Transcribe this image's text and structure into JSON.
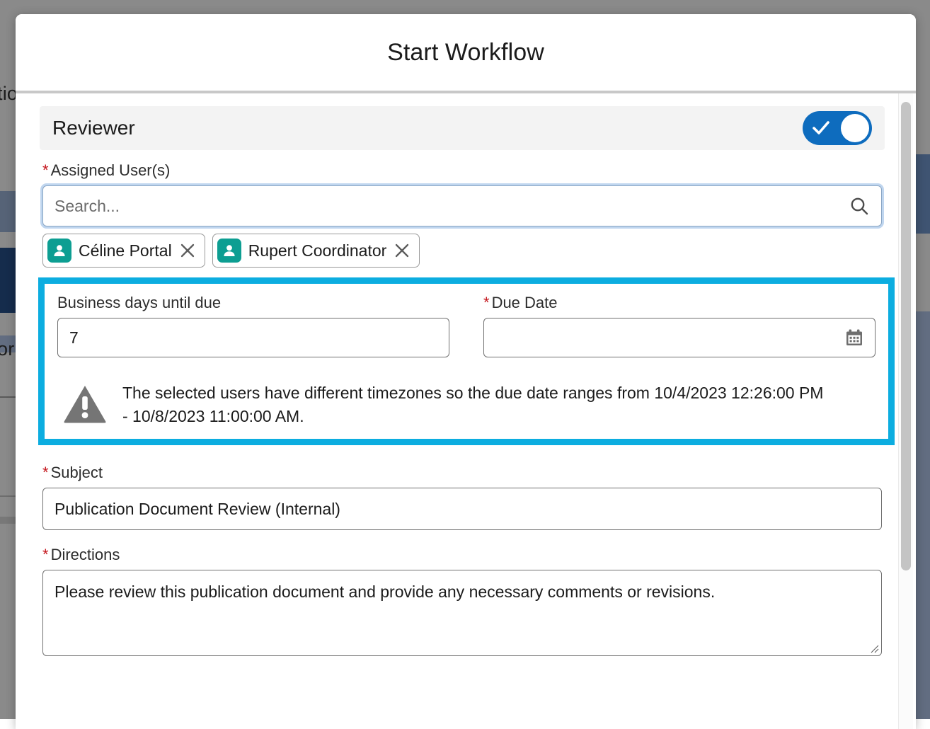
{
  "modal": {
    "title": "Start Workflow"
  },
  "section": {
    "title": "Reviewer",
    "toggle_icon": "check-icon",
    "toggle_state": "on",
    "toggle_color": "#0e6cbe"
  },
  "assigned_users": {
    "label": "Assigned User(s)",
    "required_marker": "*",
    "search_placeholder": "Search...",
    "search_value": "",
    "search_icon": "search-icon",
    "chips": [
      {
        "name": "Céline Portal",
        "avatar_icon": "user-avatar-icon",
        "remove_icon": "close-icon"
      },
      {
        "name": "Rupert Coordinator",
        "avatar_icon": "user-avatar-icon",
        "remove_icon": "close-icon"
      }
    ],
    "avatar_color": "#0d9e92"
  },
  "highlight": {
    "border_color": "#0cade0",
    "business_days": {
      "label": "Business days until due",
      "value": "7"
    },
    "due_date": {
      "label": "Due Date",
      "required_marker": "*",
      "value": "",
      "calendar_icon": "calendar-icon"
    },
    "warning": {
      "icon": "warning-triangle-icon",
      "text": "The selected users have different timezones so the due date ranges from 10/4/2023 12:26:00 PM - 10/8/2023 11:00:00 AM."
    }
  },
  "subject": {
    "label": "Subject",
    "required_marker": "*",
    "value": "Publication Document Review (Internal)"
  },
  "directions": {
    "label": "Directions",
    "required_marker": "*",
    "value": "Please review this publication document and provide any necessary comments or revisions."
  },
  "scrollbar": {
    "orientation": "vertical"
  },
  "background": {
    "text_fragment_top": "tio",
    "text_fragment_mid": "or"
  }
}
